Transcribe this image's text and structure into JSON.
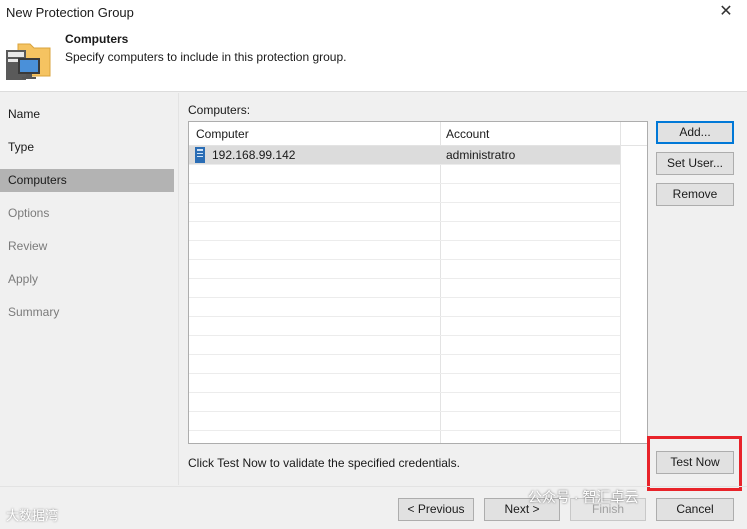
{
  "window": {
    "title": "New Protection Group",
    "close_glyph": "✕"
  },
  "header": {
    "title": "Computers",
    "subtitle": "Specify computers to include in this protection group."
  },
  "nav": {
    "items": [
      {
        "label": "Name",
        "state": "done"
      },
      {
        "label": "Type",
        "state": "done"
      },
      {
        "label": "Computers",
        "state": "active"
      },
      {
        "label": "Options",
        "state": "pending"
      },
      {
        "label": "Review",
        "state": "pending"
      },
      {
        "label": "Apply",
        "state": "pending"
      },
      {
        "label": "Summary",
        "state": "pending"
      }
    ]
  },
  "computers": {
    "label": "Computers:",
    "columns": [
      "Computer",
      "Account"
    ],
    "rows": [
      {
        "computer": "192.168.99.142",
        "account": "administratro"
      }
    ]
  },
  "actions": {
    "add": "Add...",
    "set_user": "Set User...",
    "remove": "Remove",
    "test_now": "Test Now"
  },
  "hint": "Click Test Now to validate the specified credentials.",
  "footer": {
    "previous": "< Previous",
    "next": "Next >",
    "finish": "Finish",
    "cancel": "Cancel"
  },
  "watermarks": {
    "left": "大数据湾",
    "right": "公众号 · 智汇卓云"
  },
  "colors": {
    "highlight_box": "#e8232a",
    "primary_border": "#0078d7",
    "nav_active": "#b3b3b3"
  }
}
